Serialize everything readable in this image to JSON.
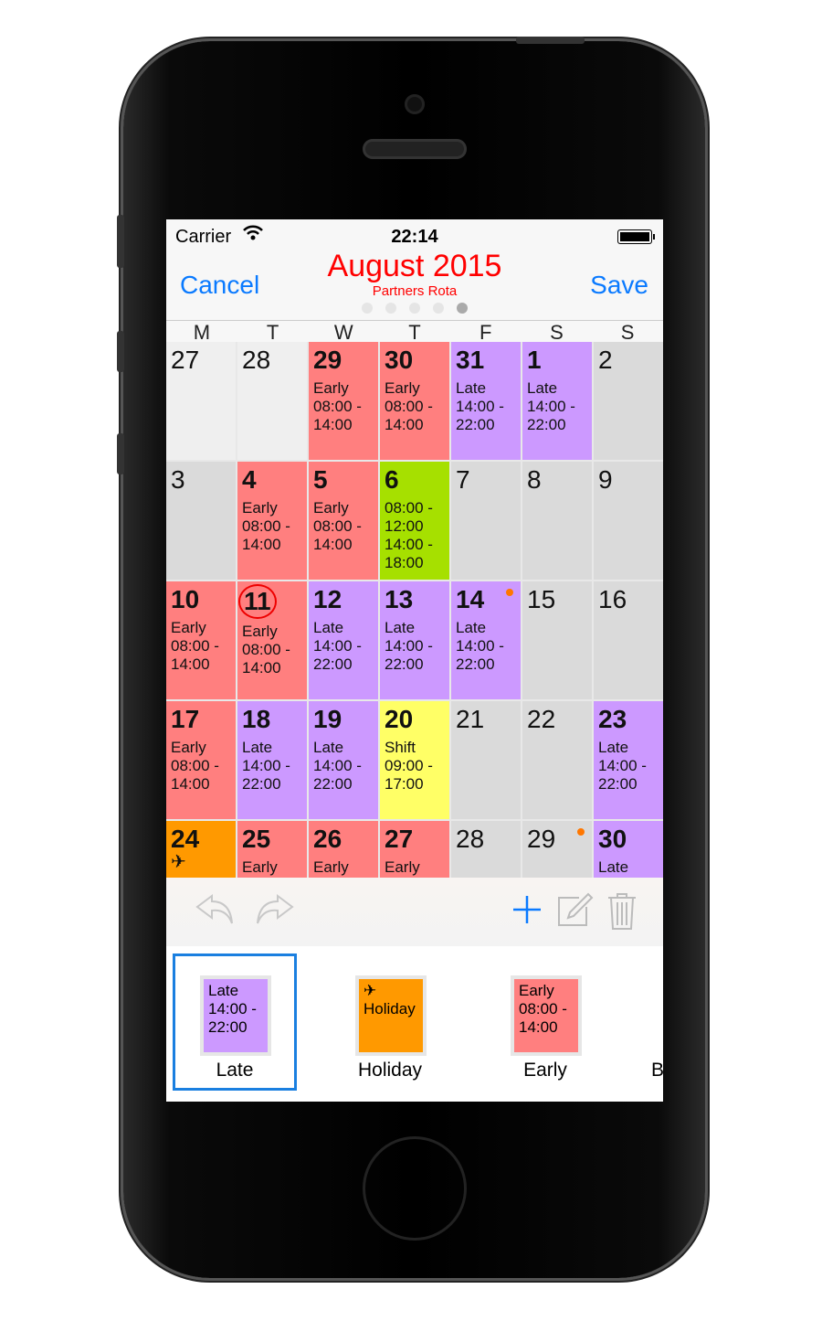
{
  "status_bar": {
    "carrier": "Carrier",
    "time": "22:14",
    "wifi_icon": "wifi-icon",
    "battery_icon": "battery-icon"
  },
  "header": {
    "cancel_label": "Cancel",
    "save_label": "Save",
    "title": "August 2015",
    "subtitle": "Partners Rota",
    "title_color": "#ff0000",
    "page_count": 5,
    "active_page": 5
  },
  "colors": {
    "early": "#ff7f7f",
    "late": "#cc99ff",
    "split": "#a6e000",
    "shift": "#ffff66",
    "holiday": "#ff9900",
    "off": "#dadada",
    "outside": "#efefef",
    "accent": "#0a7aff"
  },
  "weekdays": [
    "M",
    "T",
    "W",
    "T",
    "F",
    "S",
    "S"
  ],
  "weeks": [
    [
      {
        "day": "27",
        "color": "outside",
        "lines": []
      },
      {
        "day": "28",
        "color": "outside",
        "lines": []
      },
      {
        "day": "29",
        "color": "early",
        "bold": true,
        "lines": [
          "Early",
          "08:00 -",
          "14:00"
        ]
      },
      {
        "day": "30",
        "color": "early",
        "bold": true,
        "lines": [
          "Early",
          "08:00 -",
          "14:00"
        ]
      },
      {
        "day": "31",
        "color": "late",
        "bold": true,
        "lines": [
          "Late",
          "14:00 -",
          "22:00"
        ]
      },
      {
        "day": "1",
        "color": "late",
        "bold": true,
        "lines": [
          "Late",
          "14:00 -",
          "22:00"
        ]
      },
      {
        "day": "2",
        "color": "off",
        "lines": []
      }
    ],
    [
      {
        "day": "3",
        "color": "off",
        "lines": []
      },
      {
        "day": "4",
        "color": "early",
        "bold": true,
        "lines": [
          "Early",
          "08:00 -",
          "14:00"
        ]
      },
      {
        "day": "5",
        "color": "early",
        "bold": true,
        "lines": [
          "Early",
          "08:00 -",
          "14:00"
        ]
      },
      {
        "day": "6",
        "color": "split",
        "bold": true,
        "lines": [
          "08:00 -",
          "12:00",
          "14:00 -",
          "18:00"
        ]
      },
      {
        "day": "7",
        "color": "off",
        "lines": []
      },
      {
        "day": "8",
        "color": "off",
        "lines": []
      },
      {
        "day": "9",
        "color": "off",
        "lines": []
      }
    ],
    [
      {
        "day": "10",
        "color": "early",
        "bold": true,
        "lines": [
          "Early",
          "08:00 -",
          "14:00"
        ]
      },
      {
        "day": "11",
        "color": "early",
        "bold": true,
        "today": true,
        "lines": [
          "Early",
          "08:00 -",
          "14:00"
        ]
      },
      {
        "day": "12",
        "color": "late",
        "bold": true,
        "lines": [
          "Late",
          "14:00 -",
          "22:00"
        ]
      },
      {
        "day": "13",
        "color": "late",
        "bold": true,
        "lines": [
          "Late",
          "14:00 -",
          "22:00"
        ]
      },
      {
        "day": "14",
        "color": "late",
        "bold": true,
        "dot": true,
        "lines": [
          "Late",
          "14:00 -",
          "22:00"
        ]
      },
      {
        "day": "15",
        "color": "off",
        "lines": []
      },
      {
        "day": "16",
        "color": "off",
        "lines": []
      }
    ],
    [
      {
        "day": "17",
        "color": "early",
        "bold": true,
        "lines": [
          "Early",
          "08:00 -",
          "14:00"
        ]
      },
      {
        "day": "18",
        "color": "late",
        "bold": true,
        "lines": [
          "Late",
          "14:00 -",
          "22:00"
        ]
      },
      {
        "day": "19",
        "color": "late",
        "bold": true,
        "lines": [
          "Late",
          "14:00 -",
          "22:00"
        ]
      },
      {
        "day": "20",
        "color": "shift",
        "bold": true,
        "lines": [
          "Shift",
          "09:00 -",
          "17:00"
        ]
      },
      {
        "day": "21",
        "color": "off",
        "lines": []
      },
      {
        "day": "22",
        "color": "off",
        "lines": []
      },
      {
        "day": "23",
        "color": "late",
        "bold": true,
        "lines": [
          "Late",
          "14:00 -",
          "22:00"
        ]
      }
    ],
    [
      {
        "day": "24",
        "color": "holiday",
        "bold": true,
        "icon": "✈",
        "lines": []
      },
      {
        "day": "25",
        "color": "early",
        "bold": true,
        "lines": [
          "Early"
        ]
      },
      {
        "day": "26",
        "color": "early",
        "bold": true,
        "lines": [
          "Early"
        ]
      },
      {
        "day": "27",
        "color": "early",
        "bold": true,
        "lines": [
          "Early"
        ]
      },
      {
        "day": "28",
        "color": "off",
        "lines": []
      },
      {
        "day": "29",
        "color": "off",
        "dot": true,
        "lines": []
      },
      {
        "day": "30",
        "color": "late",
        "bold": true,
        "lines": [
          "Late"
        ]
      }
    ]
  ],
  "toolbar": {
    "undo_icon": "undo-icon",
    "redo_icon": "redo-icon",
    "add_icon": "plus-icon",
    "edit_icon": "edit-icon",
    "delete_icon": "trash-icon"
  },
  "palette": [
    {
      "label": "Late",
      "color": "late",
      "lines": [
        "Late",
        "14:00 -",
        "22:00"
      ],
      "selected": true
    },
    {
      "label": "Holiday",
      "color": "holiday",
      "icon": "✈",
      "lines": [
        "Holiday"
      ]
    },
    {
      "label": "Early",
      "color": "early",
      "lines": [
        "Early",
        "08:00 -",
        "14:00"
      ]
    },
    {
      "label": "B",
      "color": "",
      "lines": []
    }
  ]
}
